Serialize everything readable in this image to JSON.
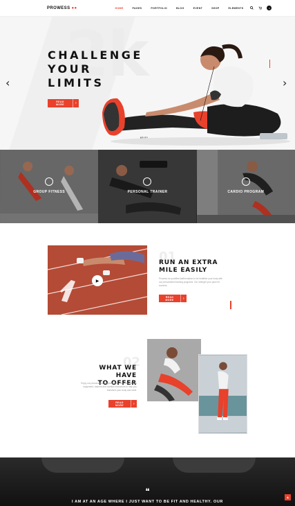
{
  "header": {
    "logo": "PROWESS",
    "nav": [
      "HOME",
      "PAGES",
      "PORTFOLIO",
      "BLOG",
      "EVENT",
      "SHOP",
      "ELEMENTS"
    ],
    "active": "HOME",
    "cart_count": "0"
  },
  "hero": {
    "title_line1": "CHALLENGE",
    "title_line2": "YOUR LIMITS",
    "button": "READ MORE",
    "counter": "01/11"
  },
  "services": [
    {
      "title": "GROUP FITNESS"
    },
    {
      "title": "PERSONAL TRAINER"
    },
    {
      "title": "CARDIO PROGRAM"
    }
  ],
  "run": {
    "number": "01",
    "title_line1": "RUN AN EXTRA",
    "title_line2": "MILE EASILY",
    "text": "Prowess lor yourlifes fastlformation to be healthier your body with our personalized training programs. Our strength your pace for success.",
    "button": "READ MORE"
  },
  "offer": {
    "number": "02",
    "title_line1": "WHAT WE HAVE",
    "title_line2": "TO OFFER",
    "text": "Enjoy our personalized programs with outstanding fitness equipment, trainers and nutrition instructors to help you transform your body and mind.",
    "button": "READ MORE"
  },
  "testimonial": {
    "quote_mark": "❝",
    "text": "I AM AT AN AGE WHERE I JUST WANT TO BE FIT AND HEALTHY. OUR"
  },
  "colors": {
    "accent": "#e8412c",
    "dark": "#111111"
  }
}
